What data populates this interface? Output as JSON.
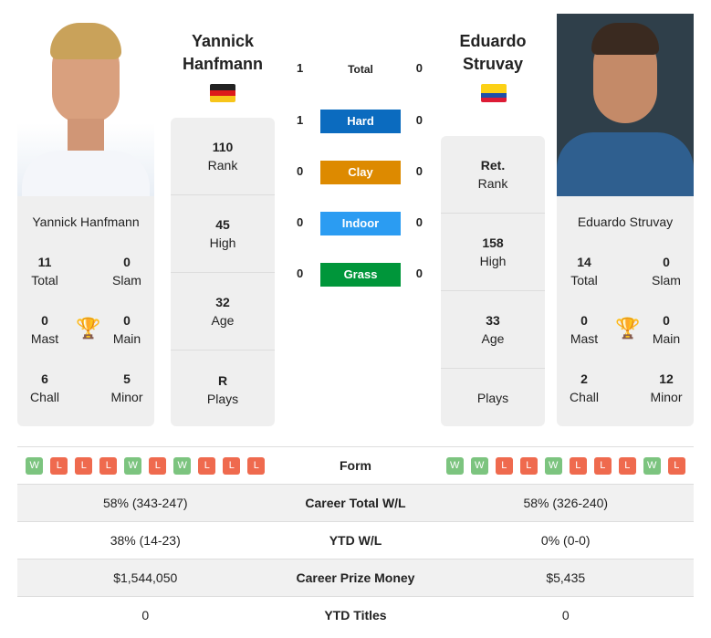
{
  "player1": {
    "name_line1": "Yannick",
    "name_line2": "Hanfmann",
    "full_name": "Yannick Hanfmann",
    "flag": "germany-flag",
    "titles": {
      "total": "11",
      "slam": "0",
      "mast": "0",
      "main": "0",
      "chall": "6",
      "minor": "5"
    },
    "stats": {
      "rank": "110",
      "high": "45",
      "age": "32",
      "plays": "R"
    },
    "form": [
      "W",
      "L",
      "L",
      "L",
      "W",
      "L",
      "W",
      "L",
      "L",
      "L"
    ],
    "career_wl": "58% (343-247)",
    "ytd_wl": "38% (14-23)",
    "prize": "$1,544,050",
    "ytd_titles": "0"
  },
  "player2": {
    "name_line1": "Eduardo",
    "name_line2": "Struvay",
    "full_name": "Eduardo Struvay",
    "flag": "colombia-flag",
    "titles": {
      "total": "14",
      "slam": "0",
      "mast": "0",
      "main": "0",
      "chall": "2",
      "minor": "12"
    },
    "stats": {
      "rank": "Ret.",
      "high": "158",
      "age": "33",
      "plays": ""
    },
    "form": [
      "W",
      "W",
      "L",
      "L",
      "W",
      "L",
      "L",
      "L",
      "W",
      "L"
    ],
    "career_wl": "58% (326-240)",
    "ytd_wl": "0% (0-0)",
    "prize": "$5,435",
    "ytd_titles": "0"
  },
  "labels": {
    "total": "Total",
    "slam": "Slam",
    "mast": "Mast",
    "main": "Main",
    "chall": "Chall",
    "minor": "Minor",
    "rank": "Rank",
    "high": "High",
    "age": "Age",
    "plays": "Plays",
    "form": "Form",
    "career_wl": "Career Total W/L",
    "ytd_wl": "YTD W/L",
    "prize": "Career Prize Money",
    "ytd_titles": "YTD Titles"
  },
  "h2h": [
    {
      "label": "Total",
      "p1": "1",
      "p2": "0"
    },
    {
      "label": "Hard",
      "p1": "1",
      "p2": "0",
      "color": "#0b6bbf"
    },
    {
      "label": "Clay",
      "p1": "0",
      "p2": "0",
      "color": "#dd8a00"
    },
    {
      "label": "Indoor",
      "p1": "0",
      "p2": "0",
      "color": "#2b9cf2"
    },
    {
      "label": "Grass",
      "p1": "0",
      "p2": "0",
      "color": "#00963a"
    }
  ],
  "colors": {
    "win": "#7cc47f",
    "loss": "#ef6a4e",
    "trophy": "#3a73b8"
  }
}
